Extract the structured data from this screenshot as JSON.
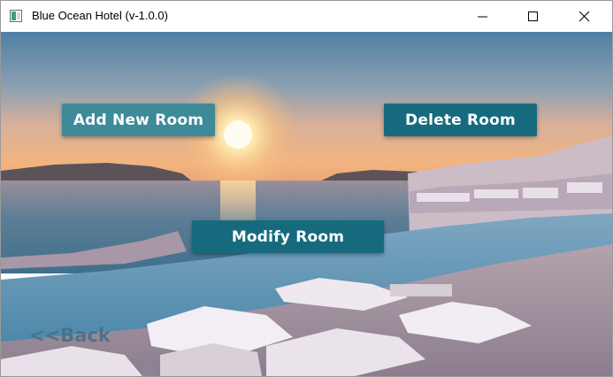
{
  "window": {
    "title": "Blue Ocean Hotel (v-1.0.0)"
  },
  "actions": {
    "add_room": "Add New Room",
    "delete_room": "Delete Room",
    "modify_room": "Modify Room"
  },
  "navigation": {
    "back": "<<Back"
  },
  "colors": {
    "button_light": "#3d8a99",
    "button_dark": "#176a7e",
    "back_link": "#46708a"
  }
}
